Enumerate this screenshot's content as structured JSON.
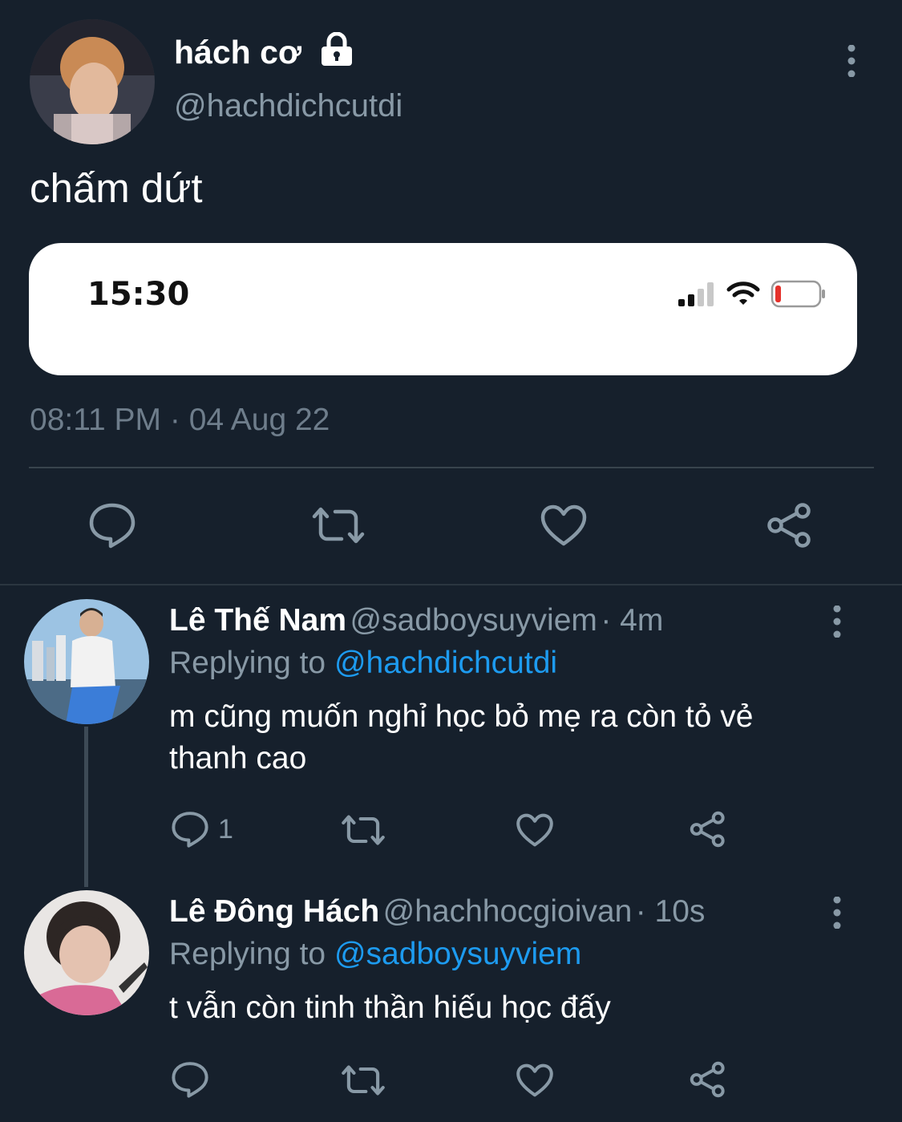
{
  "tweet": {
    "display_name": "hách cơ",
    "handle": "@hachdichcutdi",
    "text": "chấm dứt",
    "card": {
      "time": "15:30",
      "battery_color": "#e5312b"
    },
    "timestamp": "08:11 PM · 04 Aug 22",
    "actions": [
      "reply-icon",
      "retweet-icon",
      "like-icon",
      "share-icon"
    ]
  },
  "replies": [
    {
      "name": "Lê Thế Nam",
      "handle": "@sadboysuyviem",
      "time": "· 4m",
      "replying_prefix": "Replying to",
      "replying_to": "@hachdichcutdi",
      "text_line1": "m cũng muốn nghỉ học bỏ mẹ ra còn tỏ vẻ",
      "text_line2": "thanh cao",
      "reply_count": "1"
    },
    {
      "name": "Lê Đông Hách",
      "handle": "@hachhocgioivan",
      "time": "· 10s",
      "replying_prefix": "Replying to",
      "replying_to": "@sadboysuyviem",
      "text_line1": "t vẫn còn tinh thần hiếu học đấy"
    }
  ],
  "colors": {
    "background": "#16202c",
    "muted": "#8899a6",
    "link": "#1d9bf0",
    "icon": "#8899a6"
  }
}
